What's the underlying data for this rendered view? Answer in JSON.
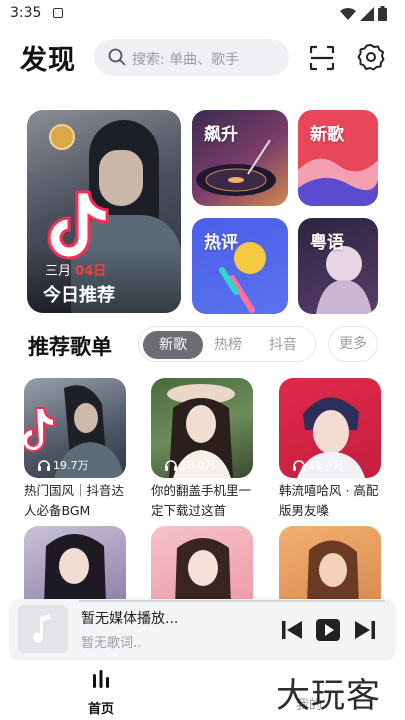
{
  "status_bar": {
    "time": "3:35"
  },
  "header": {
    "title": "发现",
    "search_placeholder": "搜索: 单曲、歌手"
  },
  "featured": {
    "big": {
      "month": "三月",
      "day": "04日",
      "label": "今日推荐"
    },
    "minis": [
      {
        "label": "飙升"
      },
      {
        "label": "新歌"
      },
      {
        "label": "热评"
      },
      {
        "label": "粤语"
      }
    ]
  },
  "recommend": {
    "title": "推荐歌单",
    "tabs": [
      "新歌",
      "热榜",
      "抖音"
    ],
    "active_tab": "新歌",
    "more": "更多"
  },
  "playlists": [
    {
      "count": "19.7万",
      "title": "热门国风｜抖音达人必备BGM"
    },
    {
      "count": "18.0万",
      "title": "你的翻盖手机里一定下载过这首"
    },
    {
      "count": "11.4万",
      "title": "韩流嘻哈风 · 高配版男友嗓"
    }
  ],
  "player": {
    "title": "暂无媒体播放...",
    "lyric": "暂无歌词.."
  },
  "bottom_nav": {
    "home": "首页",
    "mine": "我的"
  },
  "watermark": "大玩客",
  "colors": {
    "accent_red": "#ff3a3a",
    "tab_active": "#6c6d73",
    "search_bg": "#eef0f4"
  }
}
